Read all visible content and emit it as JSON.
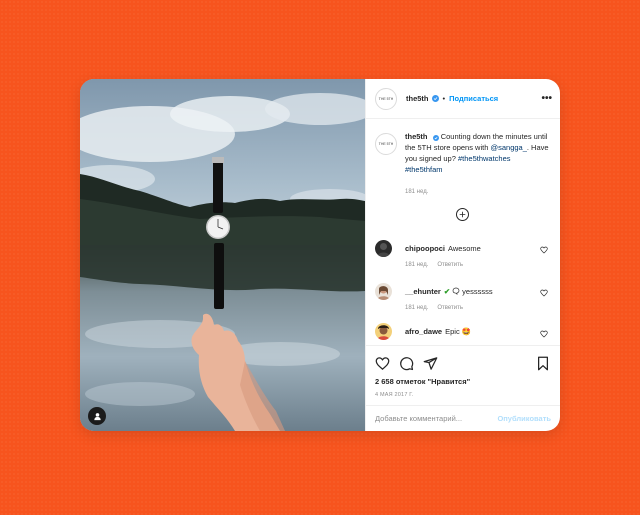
{
  "post": {
    "username": "the5th",
    "logo_text": "THE 5TH",
    "separator": "•",
    "follow_label": "Подписаться",
    "more_label": "•••",
    "caption": {
      "username": "the5th",
      "text_before": "Counting down the minutes until the 5TH store opens with",
      "mention": "@sangga_",
      "text_after": ". Have you signed up?",
      "hashtags": "#the5thwatches #the5thfam",
      "time": "181 нед."
    },
    "comments": [
      {
        "username": "chipoopoci",
        "text": "Awesome",
        "time": "181 нед.",
        "reply": "Ответить"
      },
      {
        "username": "__ehunter",
        "text": "yessssss",
        "emoji": "✔",
        "time": "181 нед.",
        "reply": "Ответить"
      },
      {
        "username": "afro_dawe",
        "text": "Epic 🤩"
      }
    ],
    "likes": "2 658 отметок \"Нравится\"",
    "date": "4 МАЯ 2017 Г.",
    "add_comment_placeholder": "Добавьте комментарий...",
    "publish_label": "Опубликовать"
  },
  "icons": {
    "verified": "verified-badge-icon",
    "load_more": "plus-circle-icon",
    "like": "heart-icon",
    "comment": "comment-bubble-icon",
    "share": "paper-plane-icon",
    "save": "bookmark-icon",
    "tags": "user-tag-icon"
  },
  "colors": {
    "background": "#f7541e",
    "follow": "#0095f6",
    "verified": "#3897f0",
    "publish_disabled": "#b2dffc"
  }
}
